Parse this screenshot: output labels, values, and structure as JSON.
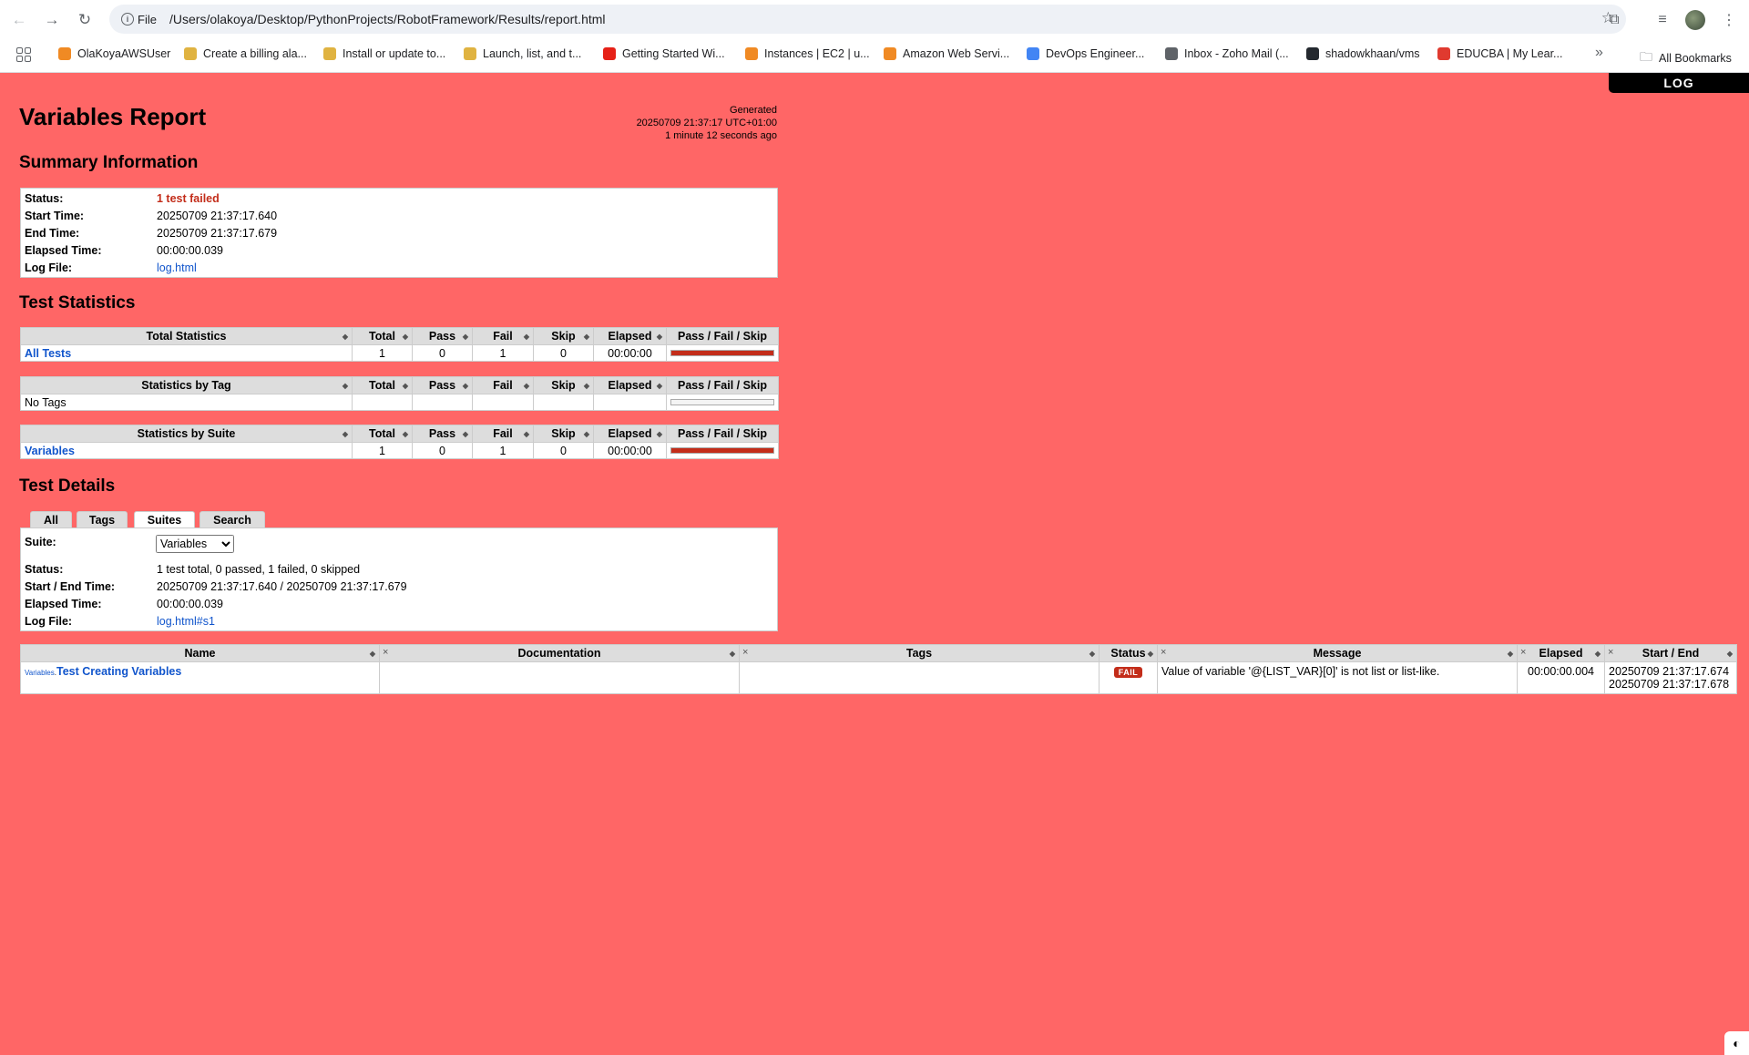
{
  "browser": {
    "site_info_label": "File",
    "url": "/Users/olakoya/Desktop/PythonProjects/RobotFramework/Results/report.html",
    "bookmarks": [
      {
        "label": "OlaKoyaAWSUser",
        "color": "#f08a24"
      },
      {
        "label": "Create a billing ala...",
        "color": "#e0b341"
      },
      {
        "label": "Install or update to...",
        "color": "#e0b341"
      },
      {
        "label": "Launch, list, and t...",
        "color": "#e0b341"
      },
      {
        "label": "Getting Started Wi...",
        "color": "#e62117"
      },
      {
        "label": "Instances | EC2 | u...",
        "color": "#f08a24"
      },
      {
        "label": "Amazon Web Servi...",
        "color": "#f08a24"
      },
      {
        "label": "DevOps Engineer...",
        "color": "#4285f4"
      },
      {
        "label": "Inbox - Zoho Mail (...",
        "color": "#5f6368"
      },
      {
        "label": "shadowkhaan/vms",
        "color": "#24292f"
      },
      {
        "label": "EDUCBA | My Lear...",
        "color": "#e03a2f"
      }
    ],
    "all_bookmarks_label": "All Bookmarks",
    "overflow_glyph": "»"
  },
  "report": {
    "log_button": "LOG",
    "title": "Variables Report",
    "generated": {
      "label": "Generated",
      "timestamp": "20250709 21:37:17 UTC+01:00",
      "ago": "1 minute 12 seconds ago"
    },
    "summary": {
      "heading": "Summary Information",
      "rows": [
        {
          "label": "Status:",
          "value": "1 test failed"
        },
        {
          "label": "Start Time:",
          "value": "20250709 21:37:17.640"
        },
        {
          "label": "End Time:",
          "value": "20250709 21:37:17.679"
        },
        {
          "label": "Elapsed Time:",
          "value": "00:00:00.039"
        },
        {
          "label": "Log File:",
          "value": "log.html"
        }
      ]
    },
    "statistics": {
      "heading": "Test Statistics",
      "columns": [
        "Total",
        "Pass",
        "Fail",
        "Skip",
        "Elapsed",
        "Pass / Fail / Skip"
      ],
      "total": {
        "title": "Total Statistics",
        "row": {
          "name": "All Tests",
          "total": "1",
          "pass": "0",
          "fail": "1",
          "skip": "0",
          "elapsed": "00:00:00",
          "fail_ratio": 1.0
        }
      },
      "by_tag": {
        "title": "Statistics by Tag",
        "row": {
          "name": "No Tags"
        }
      },
      "by_suite": {
        "title": "Statistics by Suite",
        "row": {
          "name": "Variables",
          "total": "1",
          "pass": "0",
          "fail": "1",
          "skip": "0",
          "elapsed": "00:00:00",
          "fail_ratio": 1.0
        }
      }
    },
    "details": {
      "heading": "Test Details",
      "tabs": [
        "All",
        "Tags",
        "Suites",
        "Search"
      ],
      "active_tab": "Suites",
      "suite_label": "Suite:",
      "suite_selected": "Variables",
      "rows": [
        {
          "label": "Status:",
          "value": "1 test total, 0 passed, 1 failed, 0 skipped"
        },
        {
          "label": "Start / End Time:",
          "value": "20250709 21:37:17.640 / 20250709 21:37:17.679"
        },
        {
          "label": "Elapsed Time:",
          "value": "00:00:00.039"
        },
        {
          "label": "Log File:",
          "value": "log.html#s1"
        }
      ],
      "table": {
        "columns": [
          "Name",
          "Documentation",
          "Tags",
          "Status",
          "Message",
          "Elapsed",
          "Start / End"
        ],
        "test": {
          "parent": "Variables",
          "separator": ".",
          "name": "Test Creating Variables",
          "documentation": "",
          "tags": "",
          "status": "FAIL",
          "message": "Value of variable '@{LIST_VAR}[0]' is not list or list-like.",
          "elapsed": "00:00:00.004",
          "start": "20250709 21:37:17.674",
          "end": "20250709 21:37:17.678"
        }
      }
    }
  },
  "colors": {
    "report_bg_fail": "#ff6666",
    "fail": "#c32d1a",
    "link": "#1155cc"
  }
}
